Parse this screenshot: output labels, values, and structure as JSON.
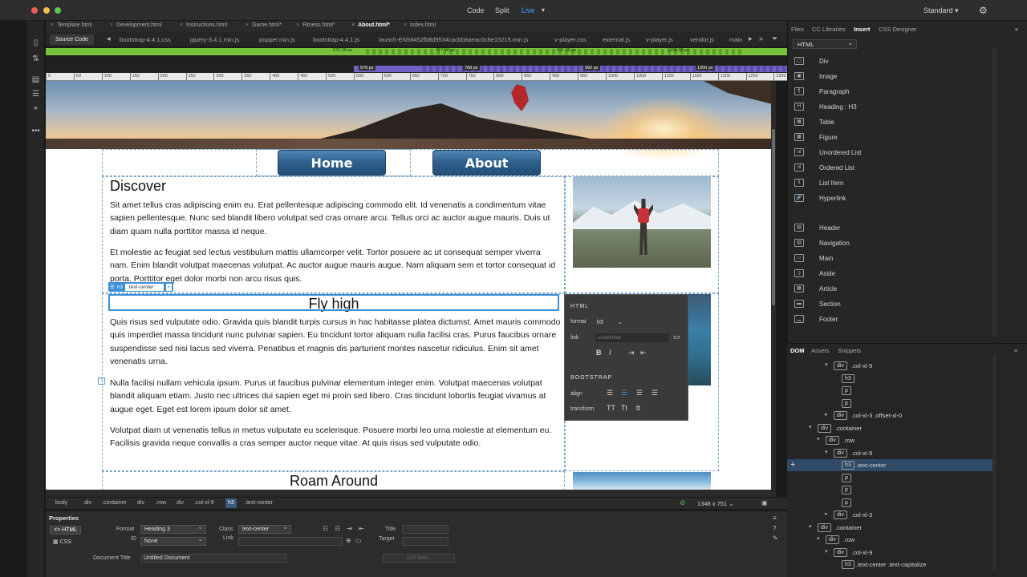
{
  "titlebar": {
    "modes": [
      "Code",
      "Split",
      "Live"
    ],
    "workspace": "Standard"
  },
  "doc_tabs": [
    {
      "label": "Template.html"
    },
    {
      "label": "Development.html"
    },
    {
      "label": "Instructions.html"
    },
    {
      "label": "Game.html*"
    },
    {
      "label": "Fitness.html*"
    },
    {
      "label": "About.html*"
    },
    {
      "label": "index.html"
    }
  ],
  "related_files": {
    "source_code": "Source Code",
    "files": [
      "bootstrap-4.4.1.css",
      "jquery-3.4.1.min.js",
      "popper.min.js",
      "bootstrap-4.4.1.js",
      "launch-EN58452fb8d9534cacbb8aeac0c8e15215.min.js",
      "v-player.css",
      "external.js",
      "v-player.js",
      "vendor.js",
      "main"
    ]
  },
  "media_queries": {
    "green": [
      "575.98 px",
      "767.98 px",
      "991.98 px",
      "1199.98 px"
    ],
    "purple": [
      "576 px",
      "768 px",
      "992 px",
      "1200 px"
    ]
  },
  "ruler": [
    "0",
    "50",
    "100",
    "150",
    "200",
    "250",
    "300",
    "350",
    "400",
    "450",
    "500",
    "550",
    "600",
    "650",
    "700",
    "750",
    "800",
    "850",
    "900",
    "950",
    "1000",
    "1050",
    "1100",
    "1150",
    "1200",
    "1250",
    "1300"
  ],
  "page": {
    "nav": [
      "Home",
      "About"
    ],
    "discover_title": "Discover",
    "discover_p1": " Sit amet tellus cras adipiscing enim eu. Erat pellentesque adipiscing commodo elit. Id venenatis a condimentum vitae sapien pellentesque. Nunc sed blandit libero volutpat sed cras ornare arcu. Tellus orci ac auctor augue mauris. Duis ut diam quam nulla porttitor massa id neque.",
    "discover_p2": "Et molestie ac feugiat sed lectus vestibulum mattis ullamcorper velit. Tortor posuere ac ut consequat semper viverra nam. Enim blandit volutpat maecenas volutpat. Ac auctor augue mauris augue. Nam aliquam sem et tortor consequat id porta. Porttitor eget dolor morbi non arcu risus quis.",
    "fly_title": "Fly high",
    "fly_p1": " Quis risus sed vulputate odio. Gravida quis blandit turpis cursus in hac habitasse platea dictumst. Amet mauris commodo quis imperdiet massa tincidunt nunc pulvinar sapien. Eu tincidunt tortor aliquam nulla facilisi cras. Purus faucibus ornare suspendisse sed nisi lacus sed viverra. Penatibus et magnis dis parturient montes nascetur ridiculus. Enim sit amet venenatis urna.",
    "fly_p2": "Nulla facilisi nullam vehicula ipsum. Purus ut faucibus pulvinar elementum integer enim. Volutpat maecenas volutpat blandit aliquam etiam. Justo nec ultrices dui sapien eget mi proin sed libero. Cras tincidunt lobortis feugiat vivamus at augue eget. Eget est lorem ipsum dolor sit amet.",
    "fly_p3": "Volutpat diam ut venenatis tellus in metus vulputate eu scelerisque. Posuere morbi leo urna molestie at elementum eu. Facilisis gravida neque convallis a cras semper auctor neque vitae. At quis risus sed vulputate odio.",
    "roam_title": "Roam Around"
  },
  "selection_tag": {
    "tag": "h3",
    "class": ".text-center",
    "plus": "+"
  },
  "hud": {
    "html_label": "HTML",
    "format_label": "format",
    "format_value": "h3",
    "link_label": "link",
    "link_placeholder": "undefined",
    "bootstrap_label": "BOOTSTRAP",
    "align_label": "align",
    "transform_label": "transform",
    "transform_opts": [
      "TT",
      "Tt",
      "tt"
    ]
  },
  "tag_selector": [
    "body",
    "div",
    ".container",
    "div",
    ".row",
    "div",
    ".col-xl-9",
    "h3",
    ".text-center"
  ],
  "viewport_size": "1348 x 751",
  "properties": {
    "title": "Properties",
    "tabs": [
      "HTML",
      "CSS"
    ],
    "format_label": "Format",
    "format_value": "Heading 3",
    "id_label": "ID",
    "id_value": "None",
    "class_label": "Class",
    "class_value": "text-center",
    "link_label": "Link",
    "title_label": "Title",
    "target_label": "Target",
    "doc_title_label": "Document Title",
    "doc_title_value": "Untitled Document",
    "list_item": "List Item..."
  },
  "right_panel": {
    "tabs": [
      "Files",
      "CC Libraries",
      "Insert",
      "CSS Designer"
    ],
    "insert_category": "HTML",
    "insert_items": [
      {
        "label": "Div",
        "icon": "div-icon"
      },
      {
        "label": "Image",
        "icon": "image-icon"
      },
      {
        "label": "Paragraph",
        "icon": "paragraph-icon"
      },
      {
        "label": "Heading : H3",
        "icon": "heading-icon"
      },
      {
        "label": "Table",
        "icon": "table-icon"
      },
      {
        "label": "Figure",
        "icon": "figure-icon"
      },
      {
        "label": "Unordered List",
        "icon": "ul-icon"
      },
      {
        "label": "Ordered List",
        "icon": "ol-icon"
      },
      {
        "label": "List Item",
        "icon": "li-icon"
      },
      {
        "label": "Hyperlink",
        "icon": "link-icon"
      },
      {
        "label": "Header",
        "icon": "header-icon"
      },
      {
        "label": "Navigation",
        "icon": "nav-icon"
      },
      {
        "label": "Main",
        "icon": "main-icon"
      },
      {
        "label": "Aside",
        "icon": "aside-icon"
      },
      {
        "label": "Article",
        "icon": "article-icon"
      },
      {
        "label": "Section",
        "icon": "section-icon"
      },
      {
        "label": "Footer",
        "icon": "footer-icon"
      }
    ],
    "icon_glyphs": [
      "▢",
      "▣",
      "¶",
      "H",
      "▦",
      "▩",
      "ul",
      "ol",
      "li",
      "🔗",
      "▤",
      "▥",
      "▭",
      "▯",
      "▦",
      "▬",
      "▁"
    ],
    "dom_tabs": [
      "DOM",
      "Assets",
      "Snippets"
    ],
    "dom_rows": [
      {
        "tag": "div",
        "cls": ".col-xl-9",
        "level": 5,
        "tog": "▾"
      },
      {
        "tag": "h3",
        "cls": "",
        "level": 6,
        "tog": ""
      },
      {
        "tag": "p",
        "cls": "",
        "level": 6,
        "tog": ""
      },
      {
        "tag": "p",
        "cls": "",
        "level": 6,
        "tog": ""
      },
      {
        "tag": "div",
        "cls": ".col-xl-3 .offset-xl-0",
        "level": 5,
        "tog": "▸"
      },
      {
        "tag": "div",
        "cls": ".container",
        "level": 3,
        "tog": "▾"
      },
      {
        "tag": "div",
        "cls": ".row",
        "level": 4,
        "tog": "▾"
      },
      {
        "tag": "div",
        "cls": ".col-xl-9",
        "level": 5,
        "tog": "▾"
      },
      {
        "tag": "h3",
        "cls": ".text-center",
        "level": 6,
        "tog": "",
        "sel": true
      },
      {
        "tag": "p",
        "cls": "",
        "level": 6,
        "tog": ""
      },
      {
        "tag": "p",
        "cls": "",
        "level": 6,
        "tog": ""
      },
      {
        "tag": "p",
        "cls": "",
        "level": 6,
        "tog": ""
      },
      {
        "tag": "div",
        "cls": ".col-xl-3",
        "level": 5,
        "tog": "▸"
      },
      {
        "tag": "div",
        "cls": ".container",
        "level": 3,
        "tog": "▾"
      },
      {
        "tag": "div",
        "cls": ".row",
        "level": 4,
        "tog": "▾"
      },
      {
        "tag": "div",
        "cls": ".col-xl-9",
        "level": 5,
        "tog": "▾"
      },
      {
        "tag": "h3",
        "cls": ".text-center .text-capitalize",
        "level": 6,
        "tog": ""
      }
    ]
  }
}
